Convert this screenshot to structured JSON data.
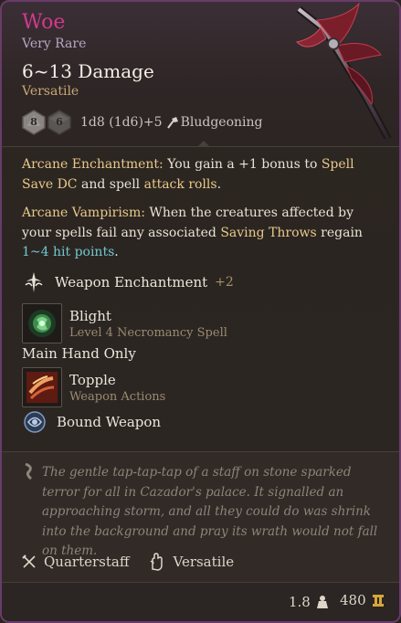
{
  "item": {
    "name": "Woe",
    "rarity": "Very Rare",
    "damage": "6~13 Damage",
    "tag": "Versatile",
    "dice": [
      "8",
      "6"
    ],
    "dice_formula": "1d8 (1d6)+5",
    "damage_type": "Bludgeoning"
  },
  "enchantments": {
    "arcane_enchantment": {
      "name": "Arcane Enchantment:",
      "text_1": " You gain a +1 bonus to ",
      "link_1": "Spell Save DC",
      "text_2": " and spell ",
      "link_2": "attack rolls",
      "text_3": "."
    },
    "arcane_vampirism": {
      "name": "Arcane Vampirism:",
      "text_1": " When the creatures affected by your spells fail any associated ",
      "link_1": "Saving Throws",
      "text_2": " regain ",
      "link_2": "1~4 hit points",
      "text_3": "."
    }
  },
  "features": {
    "weapon_enchantment": {
      "label": "Weapon Enchantment",
      "bonus": "+2"
    },
    "blight": {
      "title": "Blight",
      "subtitle": "Level 4 Necromancy Spell"
    },
    "main_hand": "Main Hand Only",
    "topple": {
      "title": "Topple",
      "subtitle": "Weapon Actions"
    },
    "bound_weapon": "Bound Weapon"
  },
  "lore": "The gentle tap-tap-tap of a staff on stone sparked terror for all in Cazador's palace. It signalled an approaching storm, and all they could do was shrink into the background and pray its wrath would not fall on them.",
  "properties": {
    "weapon_type": "Quarterstaff",
    "property": "Versatile"
  },
  "footer": {
    "weight": "1.8",
    "value": "480"
  },
  "colors": {
    "name": "#d2398d",
    "gold_keyword": "#e8c98a",
    "blue_keyword": "#6fc7cf",
    "border": "#6a3b6a"
  },
  "icons": {
    "weapon_art": "staff-head-icon",
    "dice": "dice-icon",
    "damage_type": "bludgeoning-icon",
    "enchant": "enchantment-icon",
    "blight": "blight-spell-icon",
    "topple": "topple-action-icon",
    "bound": "bound-weapon-icon",
    "lore": "lore-icon",
    "quarterstaff": "quarterstaff-icon",
    "versatile": "versatile-hand-icon",
    "weight": "weight-icon",
    "gold": "gold-icon"
  }
}
